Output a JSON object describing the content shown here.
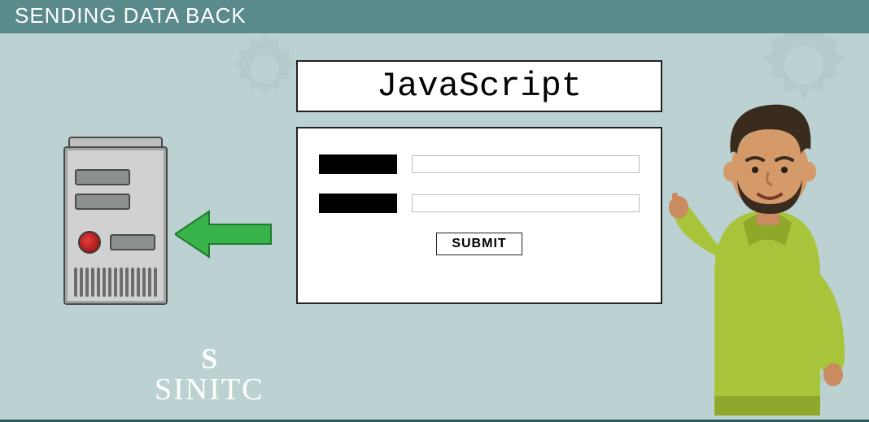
{
  "header": {
    "title": "SENDING DATA BACK"
  },
  "title_box": {
    "text": "JavaScript"
  },
  "form": {
    "submit_label": "SUBMIT"
  },
  "watermark": {
    "text": "SINITC"
  }
}
